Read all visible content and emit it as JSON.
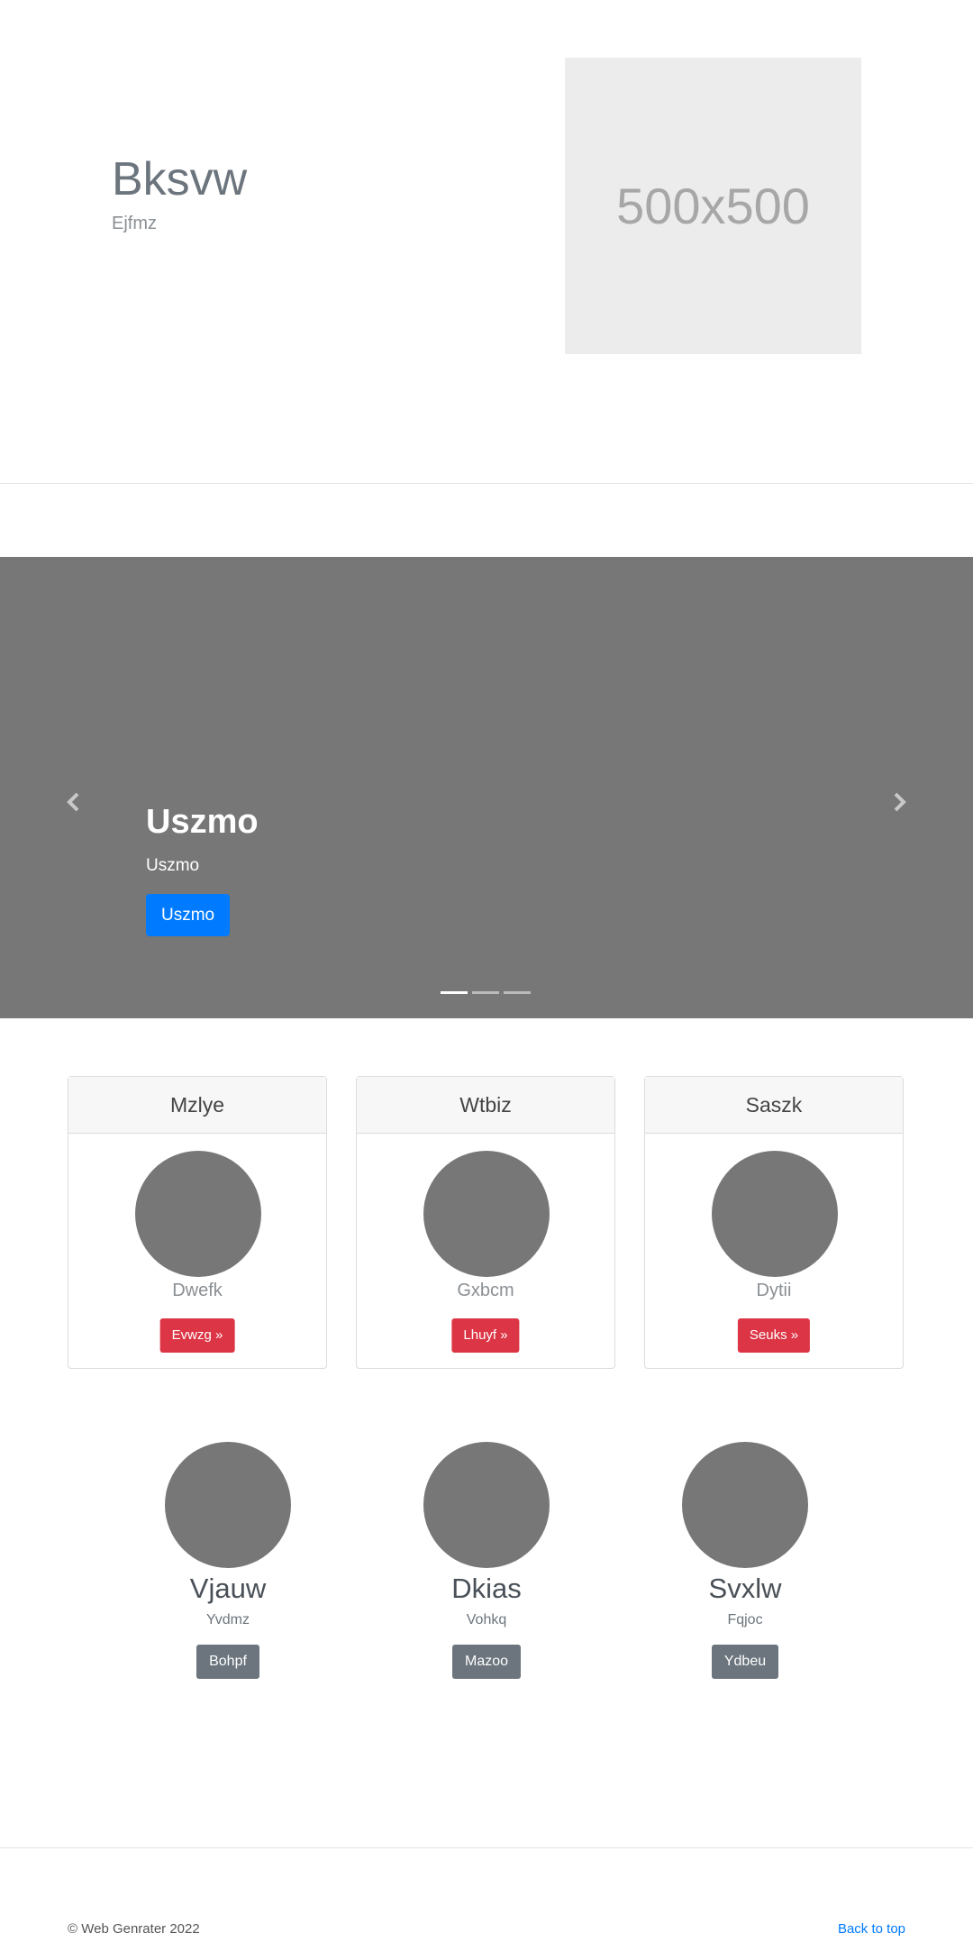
{
  "hero": {
    "title": "Bksvw",
    "subtitle": "Ejfmz",
    "image_placeholder": "500x500"
  },
  "carousel": {
    "title": "Uszmo",
    "text": "Uszmo",
    "button": "Uszmo",
    "prev_icon": "chevron-left-icon",
    "next_icon": "chevron-right-icon",
    "indicators": 3,
    "active_indicator": 0
  },
  "cards": [
    {
      "header": "Mzlye",
      "name": "Dwefk",
      "button": "Evwzg »"
    },
    {
      "header": "Wtbiz",
      "name": "Gxbcm",
      "button": "Lhuyf »"
    },
    {
      "header": "Saszk",
      "name": "Dytii",
      "button": "Seuks »"
    }
  ],
  "team": [
    {
      "name": "Vjauw",
      "role": "Yvdmz",
      "button": "Bohpf"
    },
    {
      "name": "Dkias",
      "role": "Vohkq",
      "button": "Mazoo"
    },
    {
      "name": "Svxlw",
      "role": "Fqjoc",
      "button": "Ydbeu"
    }
  ],
  "footer": {
    "copyright": "© Web Genrater 2022",
    "back_to_top": "Back to top"
  },
  "colors": {
    "primary": "#007bff",
    "danger": "#dc3545",
    "secondary": "#6c757d",
    "placeholder_gray": "#777777"
  }
}
